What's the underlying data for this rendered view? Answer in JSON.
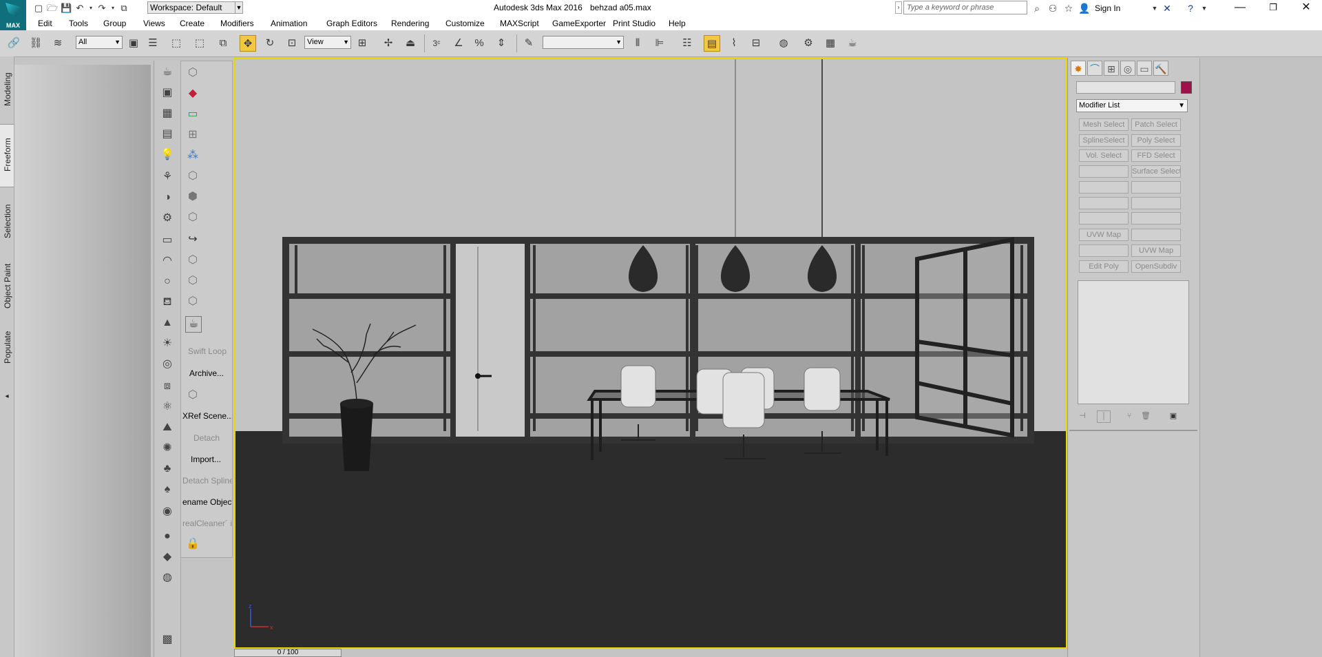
{
  "app": {
    "title": "Autodesk 3ds Max 2016",
    "file": "behzad a05.max",
    "logo_label": "MAX",
    "workspace": "Workspace: Default"
  },
  "search": {
    "placeholder": "Type a keyword or phrase"
  },
  "user": {
    "sign_in": "Sign In"
  },
  "menu": [
    "Edit",
    "Tools",
    "Group",
    "Views",
    "Create",
    "Modifiers",
    "Animation",
    "Graph Editors",
    "Rendering",
    "Customize",
    "MAXScript",
    "GameExporter",
    "Print Studio",
    "Help"
  ],
  "toolbar": {
    "selection_filter": "All",
    "ref_coord": "View",
    "snap_number": "3",
    "named_selection": ""
  },
  "ribbon_tabs": [
    "Modeling",
    "Freeform",
    "Selection",
    "Object Paint",
    "Populate"
  ],
  "ribbon_selected": "Freeform",
  "tool_labels": {
    "swift_loop": "Swift Loop",
    "archive": "Archive...",
    "xref_scene": "XRef Scene...",
    "detach": "Detach",
    "import": "Import...",
    "detach_spline": "Detach Spline",
    "rename_objects": "ename Objects",
    "real_cleaner": "realCleaner´ i"
  },
  "command_panel": {
    "modifier_list": "Modifier List",
    "buttons": [
      {
        "label": "Mesh Select"
      },
      {
        "label": "Patch Select"
      },
      {
        "label": "SplineSelect"
      },
      {
        "label": "Poly Select"
      },
      {
        "label": "Vol. Select"
      },
      {
        "label": "FFD Select"
      },
      {
        "label": ""
      },
      {
        "label": "Surface Select"
      },
      {
        "label": ""
      },
      {
        "label": ""
      },
      {
        "label": ""
      },
      {
        "label": ""
      },
      {
        "label": ""
      },
      {
        "label": ""
      },
      {
        "label": "UVW Map"
      },
      {
        "label": ""
      },
      {
        "label": ""
      },
      {
        "label": "UVW Map"
      },
      {
        "label": "Edit Poly"
      },
      {
        "label": "OpenSubdiv"
      }
    ]
  },
  "timeline": {
    "frame": "0 / 100"
  },
  "colors": {
    "viewport_border": "#f0d400",
    "active_tool": "#f5c842",
    "object_color": "#a0104a",
    "logo": "#0f6f7a"
  }
}
